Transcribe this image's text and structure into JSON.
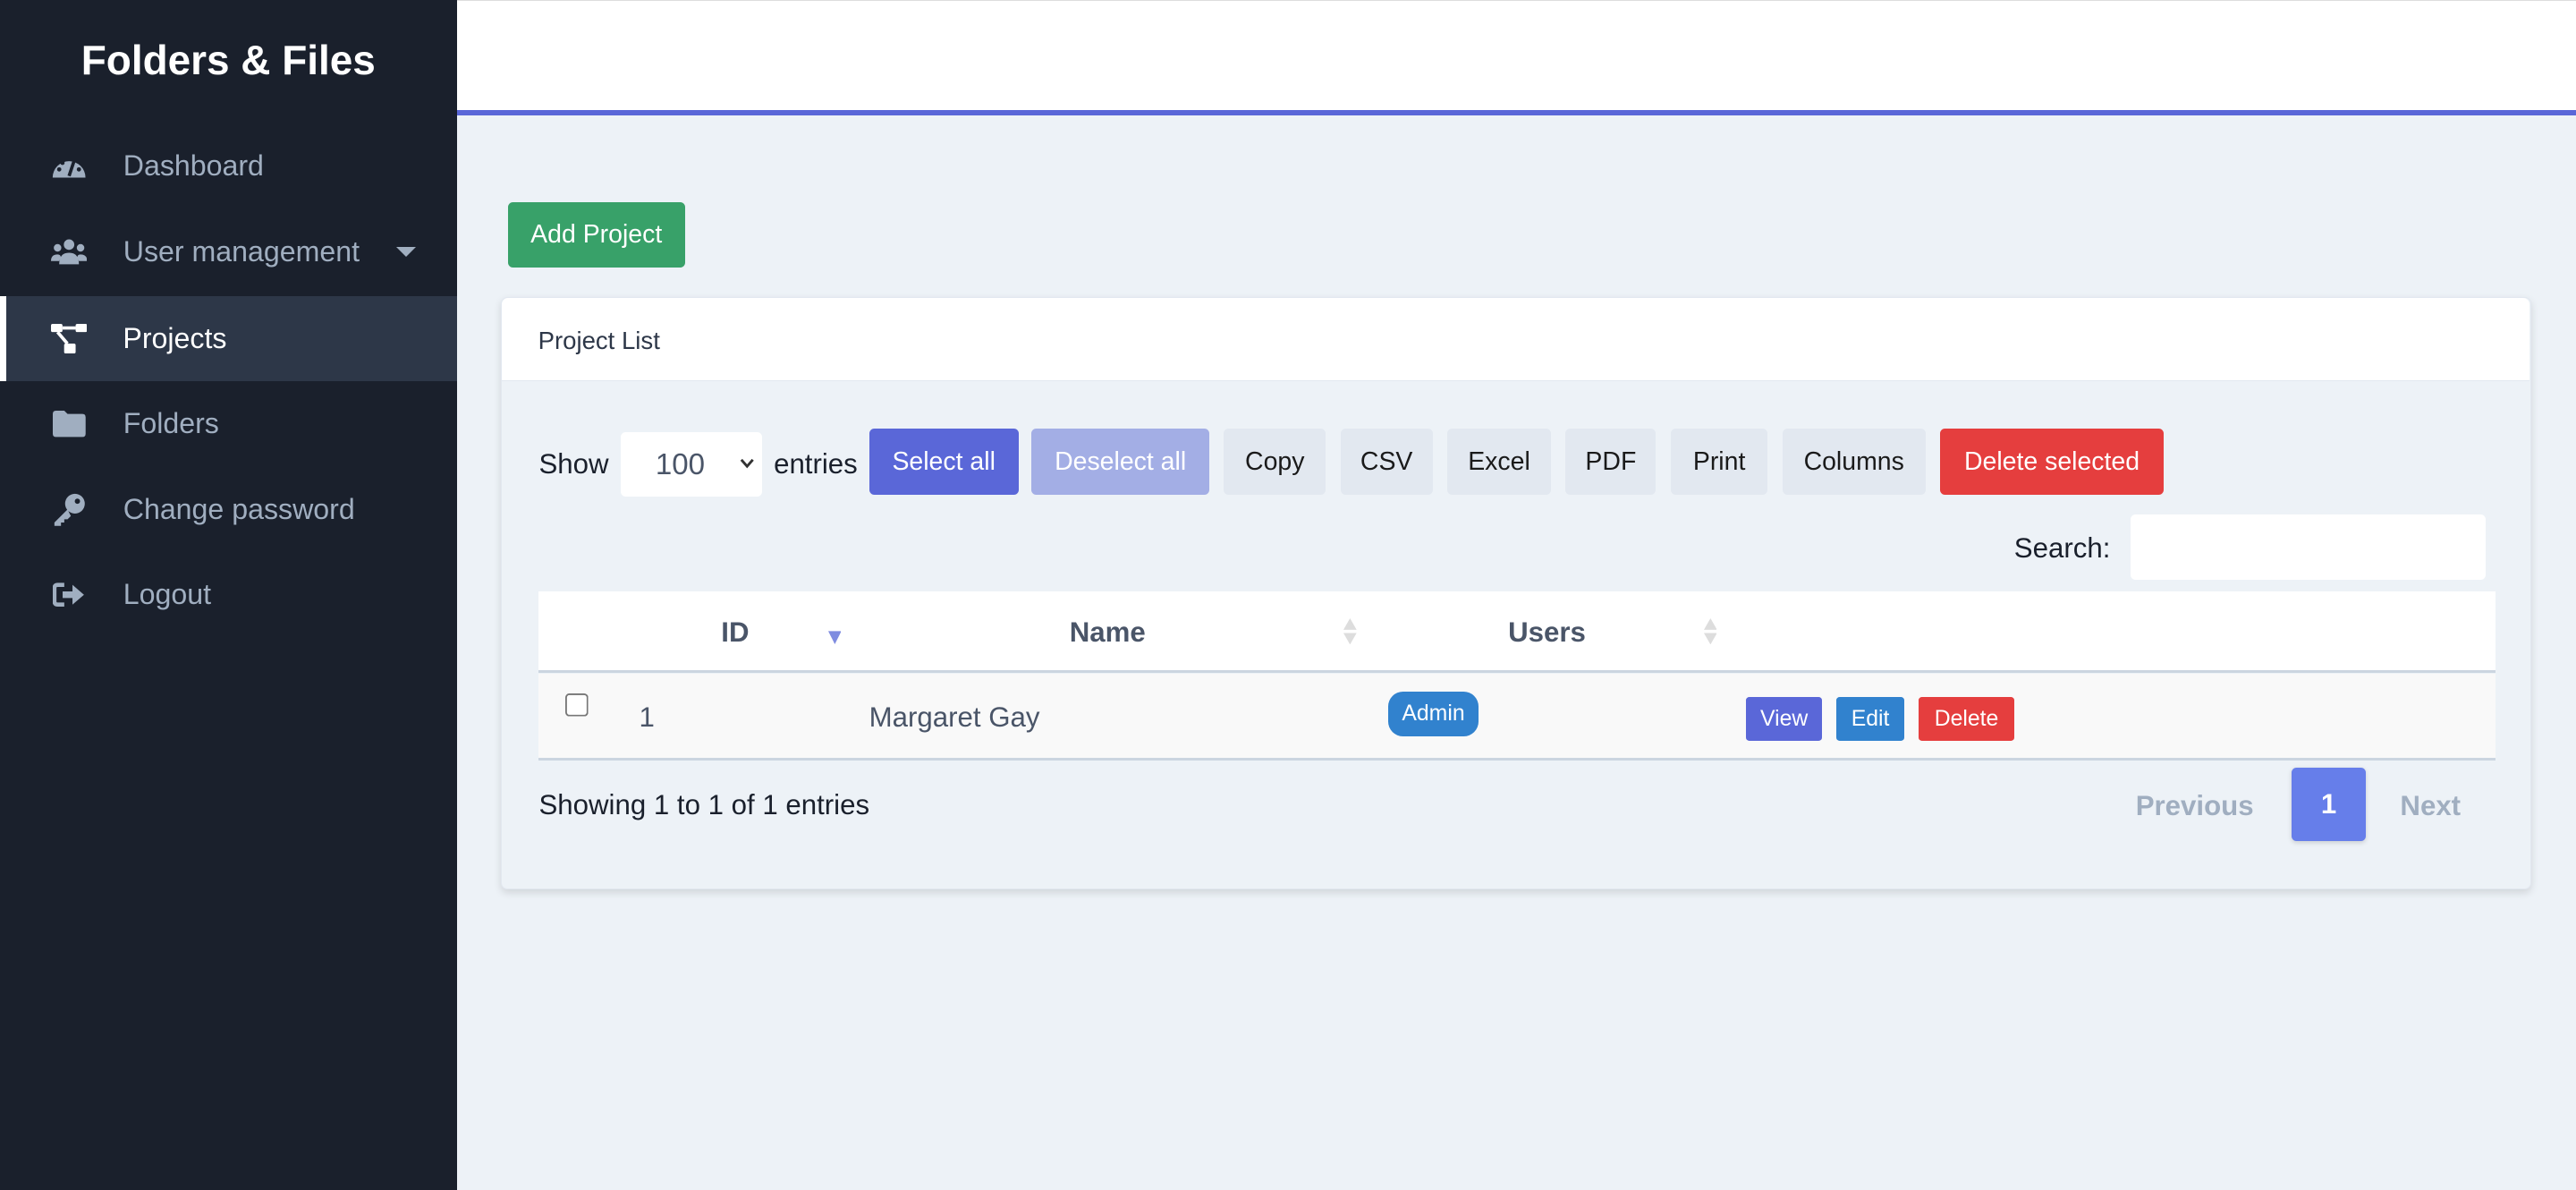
{
  "app_title": "Folders & Files",
  "sidebar": {
    "items": [
      {
        "label": "Dashboard",
        "icon": "tachometer-icon"
      },
      {
        "label": "User management",
        "icon": "users-icon",
        "has_dropdown": true
      },
      {
        "label": "Projects",
        "icon": "project-diagram-icon",
        "active": true
      },
      {
        "label": "Folders",
        "icon": "folder-icon"
      },
      {
        "label": "Change password",
        "icon": "key-icon"
      },
      {
        "label": "Logout",
        "icon": "sign-out-icon"
      }
    ]
  },
  "main": {
    "add_button": "Add Project",
    "card_title": "Project List",
    "show_label": "Show",
    "entries_value": "100",
    "entries_label": "entries",
    "toolbar": [
      "Select all",
      "Deselect all",
      "Copy",
      "CSV",
      "Excel",
      "PDF",
      "Print",
      "Columns",
      "Delete selected"
    ],
    "search_label": "Search:",
    "search_value": "",
    "table": {
      "columns": [
        "",
        "ID",
        "Name",
        "Users",
        ""
      ],
      "sorted_column": "ID",
      "sort_direction": "descending",
      "rows": [
        {
          "id": "1",
          "name": "Margaret Gay",
          "users": [
            "Admin"
          ],
          "actions": [
            "View",
            "Edit",
            "Delete"
          ]
        }
      ]
    },
    "info": "Showing 1 to 1 of 1 entries",
    "pagination": {
      "previous": "Previous",
      "current": "1",
      "next": "Next"
    }
  },
  "colors": {
    "sidebar": "#1a202c",
    "accent": "#5a67d8",
    "success": "#38a169",
    "danger": "#e53e3e",
    "info": "#3182ce",
    "page": "#667eea"
  }
}
